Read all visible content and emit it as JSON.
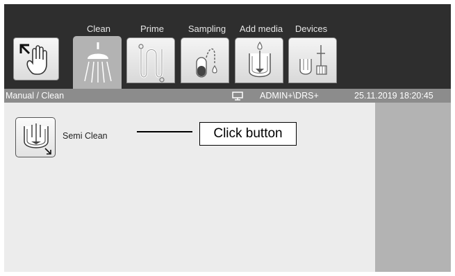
{
  "tabs": [
    {
      "label": "Clean",
      "icon": "shower-icon",
      "active": true
    },
    {
      "label": "Prime",
      "icon": "tubing-icon",
      "active": false
    },
    {
      "label": "Sampling",
      "icon": "sample-tube-icon",
      "active": false
    },
    {
      "label": "Add media",
      "icon": "media-vessel-icon",
      "active": false
    },
    {
      "label": "Devices",
      "icon": "devices-icon",
      "active": false
    }
  ],
  "status": {
    "breadcrumb": "Manual / Clean",
    "user": "ADMIN+\\DRS+",
    "datetime": "25.11.2019 18:20:45"
  },
  "main": {
    "semi_clean_label": "Semi Clean"
  },
  "annotation": {
    "text": "Click button"
  },
  "colors": {
    "topbar": "#2e2e2e",
    "statusbar": "#8c8c8c",
    "content": "#ececec",
    "rightpanel": "#b3b3b3"
  }
}
